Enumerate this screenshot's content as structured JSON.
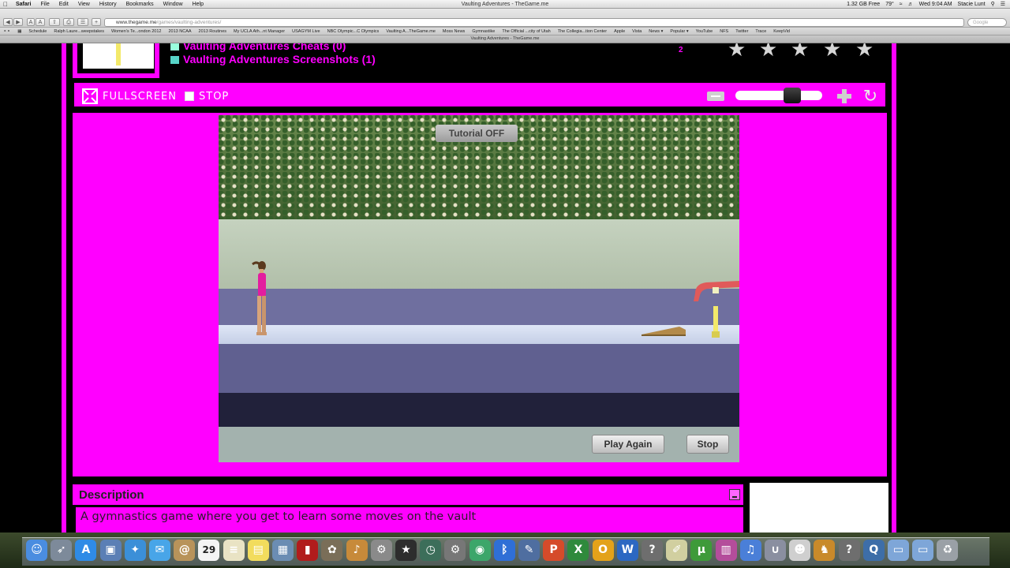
{
  "menubar": {
    "app": "Safari",
    "menus": [
      "File",
      "Edit",
      "View",
      "History",
      "Bookmarks",
      "Window",
      "Help"
    ],
    "window_title": "Vaulting Adventures - TheGame.me",
    "status": {
      "disk": "1.32 GB Free",
      "temp": "79°",
      "clock": "Wed 9:04 AM",
      "user": "Stacie Lunt"
    }
  },
  "browser": {
    "url_host": "www.thegame.me",
    "url_path": "/games/vaulting-adventures/",
    "search_placeholder": "Google",
    "bookmarks": [
      "Schedule",
      "Ralph Laure...weepstakes",
      "Women's Te...ondon 2012",
      "2013 NCAA",
      "2013 Routines",
      "My UCLA Ath...nt Manager",
      "USAGYM Live",
      "NBC Olympic...C Olympics",
      "Vaulting A...TheGame.me",
      "Moss News",
      "Gymnastike",
      "The Official ...city of Utah",
      "The Collegia...tion Center",
      "Apple",
      "Vista",
      "News ▾",
      "Popular ▾",
      "YouTube",
      "NFS",
      "Twitter",
      "Trace",
      "KeepVid"
    ],
    "tab_title": "Vaulting Adventures - TheGame.me"
  },
  "page": {
    "links": {
      "cheats": "Vaulting Adventures Cheats (0)",
      "screenshots": "Vaulting Adventures Screenshots (1)"
    },
    "rating_count": "2",
    "star_icons": [
      "star-icon",
      "star-icon",
      "star-icon",
      "star-icon",
      "star-icon"
    ],
    "controls": {
      "fullscreen_label": "FULLSCREEN",
      "stop_label": "STOP",
      "zoom_level": 0.65
    },
    "game": {
      "tutorial_label": "Tutorial OFF",
      "play_again_label": "Play Again",
      "stop_label": "Stop"
    },
    "description": {
      "title": "Description",
      "text": "A gymnastics game where you get to learn some moves on the vault"
    }
  },
  "dock": {
    "icons": [
      "finder-icon",
      "rocket-icon",
      "appstore-icon",
      "preview-icon",
      "safari-icon",
      "messages-icon",
      "contacts-icon",
      "calendar-icon",
      "notes-icon",
      "stickies-icon",
      "photos-icon",
      "photobooth-icon",
      "iphoto-icon",
      "guitar-icon",
      "systemprefs-icon",
      "star-icon",
      "timemachine-icon",
      "utility-icon",
      "facetime-icon",
      "bluetooth-icon",
      "pen-icon",
      "powerpoint-icon",
      "excel-icon",
      "outlook-icon",
      "word-icon",
      "help-icon",
      "pencil-icon",
      "torrent-icon",
      "grid-icon",
      "itunes-icon",
      "magnet-icon",
      "mask-icon",
      "bell-icon",
      "help-icon",
      "quicktime-icon",
      "folder-icon",
      "folder-icon",
      "trash-icon"
    ],
    "calendar_day": "29",
    "accent": "#ff00ff"
  }
}
